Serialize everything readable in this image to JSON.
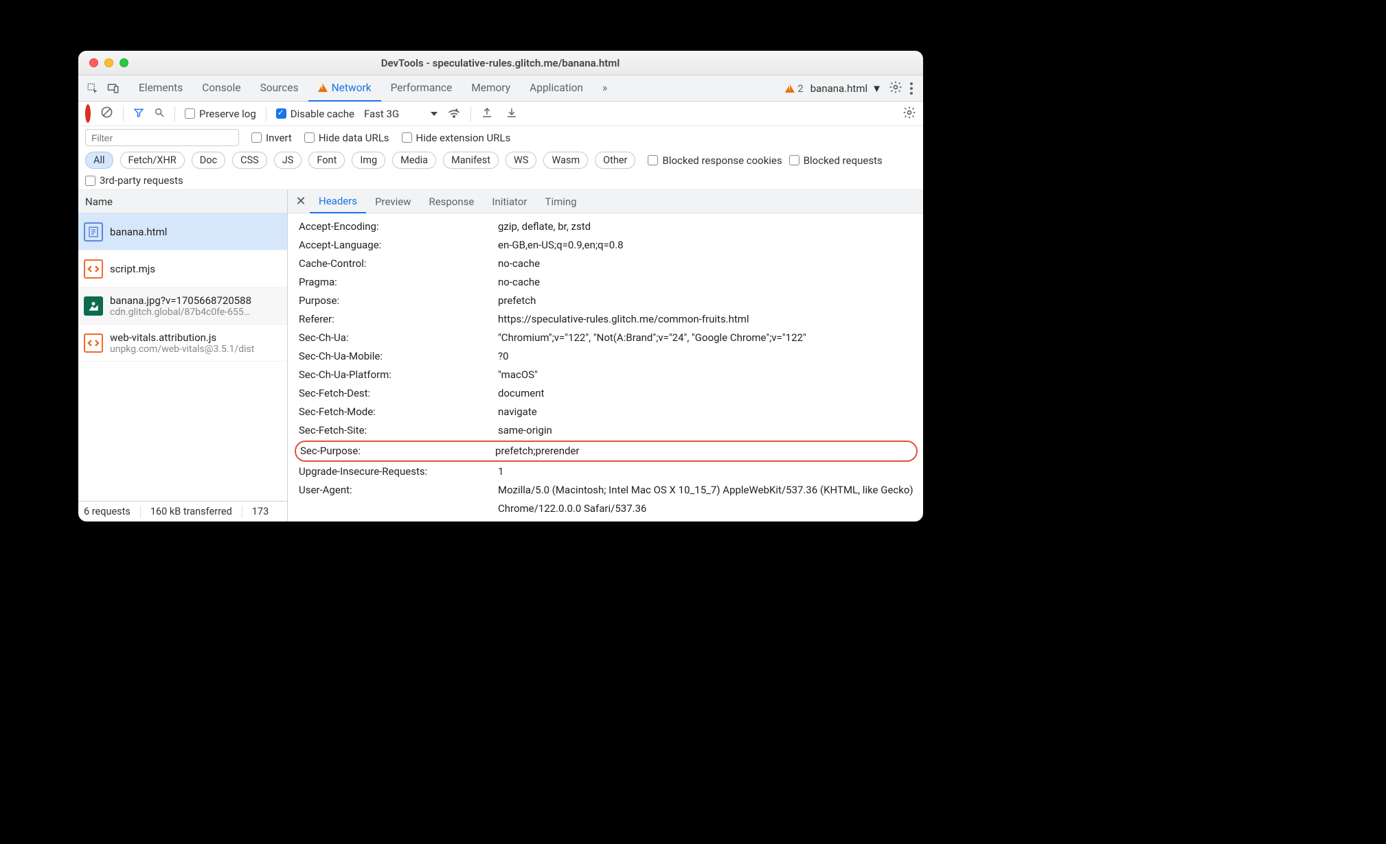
{
  "window": {
    "title": "DevTools - speculative-rules.glitch.me/banana.html"
  },
  "tabs": {
    "items": [
      "Elements",
      "Console",
      "Sources",
      "Network",
      "Performance",
      "Memory",
      "Application"
    ],
    "active": "Network",
    "more": "»",
    "warn_count": "2",
    "context": "banana.html"
  },
  "toolbar": {
    "preserve_log": "Preserve log",
    "disable_cache": "Disable cache",
    "throttling": "Fast 3G"
  },
  "filters": {
    "placeholder": "Filter",
    "invert": "Invert",
    "hide_data": "Hide data URLs",
    "hide_ext": "Hide extension URLs",
    "types": [
      "All",
      "Fetch/XHR",
      "Doc",
      "CSS",
      "JS",
      "Font",
      "Img",
      "Media",
      "Manifest",
      "WS",
      "Wasm",
      "Other"
    ],
    "blocked_cookies": "Blocked response cookies",
    "blocked_req": "Blocked requests",
    "thirdparty": "3rd-party requests"
  },
  "sidebar": {
    "header": "Name"
  },
  "requests": [
    {
      "name": "banana.html",
      "selected": true,
      "icon": "doc"
    },
    {
      "name": "script.mjs",
      "icon": "js"
    },
    {
      "name": "banana.jpg?v=1705668720588",
      "sub": "cdn.glitch.global/87b4c0fe-655…",
      "icon": "img"
    },
    {
      "name": "web-vitals.attribution.js",
      "sub": "unpkg.com/web-vitals@3.5.1/dist",
      "icon": "js"
    }
  ],
  "status": {
    "requests": "6 requests",
    "transferred": "160 kB transferred",
    "resources": "173"
  },
  "detail_tabs": {
    "items": [
      "Headers",
      "Preview",
      "Response",
      "Initiator",
      "Timing"
    ],
    "active": "Headers"
  },
  "headers": [
    {
      "k": "Accept-Encoding:",
      "v": "gzip, deflate, br, zstd"
    },
    {
      "k": "Accept-Language:",
      "v": "en-GB,en-US;q=0.9,en;q=0.8"
    },
    {
      "k": "Cache-Control:",
      "v": "no-cache"
    },
    {
      "k": "Pragma:",
      "v": "no-cache"
    },
    {
      "k": "Purpose:",
      "v": "prefetch"
    },
    {
      "k": "Referer:",
      "v": "https://speculative-rules.glitch.me/common-fruits.html"
    },
    {
      "k": "Sec-Ch-Ua:",
      "v": "\"Chromium\";v=\"122\", \"Not(A:Brand\";v=\"24\", \"Google Chrome\";v=\"122\""
    },
    {
      "k": "Sec-Ch-Ua-Mobile:",
      "v": "?0"
    },
    {
      "k": "Sec-Ch-Ua-Platform:",
      "v": "\"macOS\""
    },
    {
      "k": "Sec-Fetch-Dest:",
      "v": "document"
    },
    {
      "k": "Sec-Fetch-Mode:",
      "v": "navigate"
    },
    {
      "k": "Sec-Fetch-Site:",
      "v": "same-origin"
    },
    {
      "k": "Sec-Purpose:",
      "v": "prefetch;prerender",
      "hl": true
    },
    {
      "k": "Upgrade-Insecure-Requests:",
      "v": "1"
    },
    {
      "k": "User-Agent:",
      "v": "Mozilla/5.0 (Macintosh; Intel Mac OS X 10_15_7) AppleWebKit/537.36 (KHTML, like Gecko) Chrome/122.0.0.0 Safari/537.36"
    }
  ]
}
